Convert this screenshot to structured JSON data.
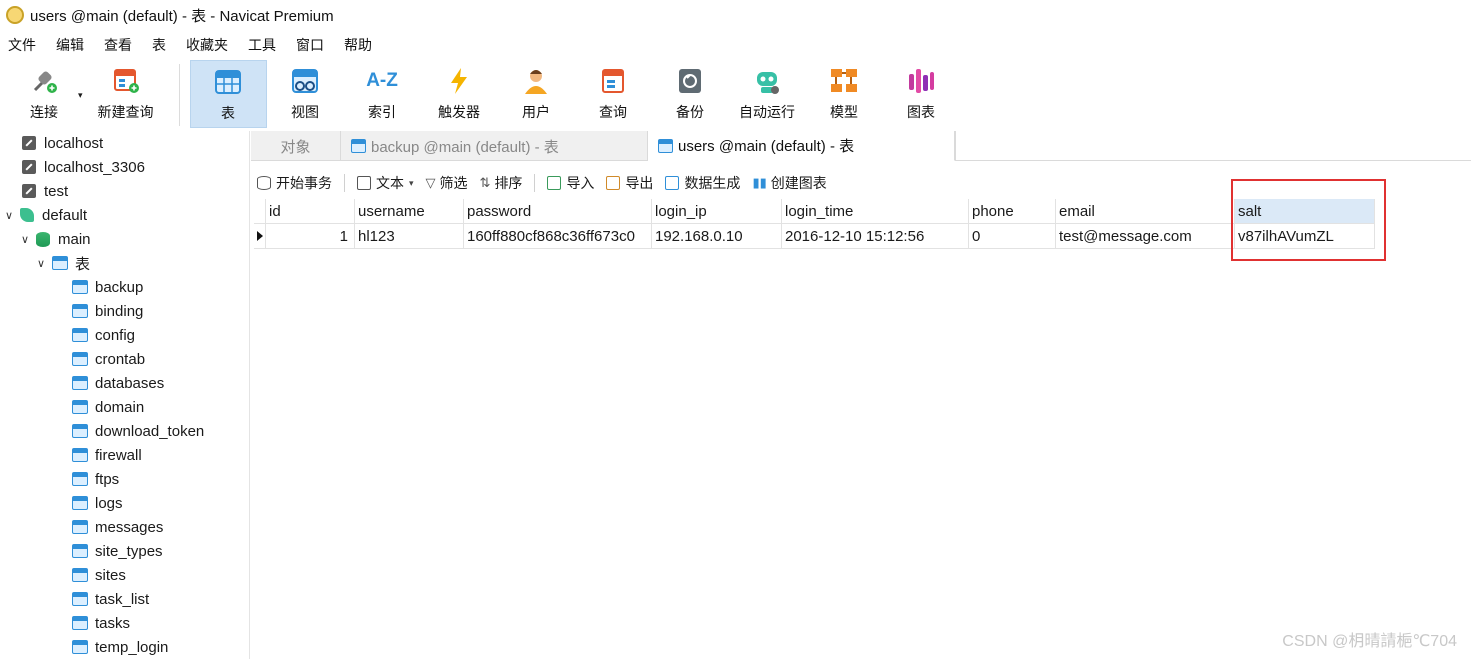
{
  "window": {
    "title": "users @main (default) - 表 - Navicat Premium"
  },
  "menu": [
    "文件",
    "编辑",
    "查看",
    "表",
    "收藏夹",
    "工具",
    "窗口",
    "帮助"
  ],
  "toolbar": {
    "connect": "连接",
    "new_query": "新建查询",
    "table": "表",
    "view": "视图",
    "index": "索引",
    "trigger": "触发器",
    "user": "用户",
    "query": "查询",
    "backup": "备份",
    "auto_run": "自动运行",
    "model": "模型",
    "chart": "图表",
    "index_icon_text": "A-Z"
  },
  "sidebar": {
    "connections": [
      "localhost",
      "localhost_3306",
      "test",
      "default"
    ],
    "database": "main",
    "tables_group": "表",
    "tables": [
      "backup",
      "binding",
      "config",
      "crontab",
      "databases",
      "domain",
      "download_token",
      "firewall",
      "ftps",
      "logs",
      "messages",
      "site_types",
      "sites",
      "task_list",
      "tasks",
      "temp_login"
    ]
  },
  "tabs": {
    "objects": "对象",
    "backup_tab": "backup @main (default) - 表",
    "users_tab": "users @main (default) - 表"
  },
  "subtoolbar": {
    "begin_transaction": "开始事务",
    "text": "文本",
    "filter": "筛选",
    "sort": "排序",
    "import": "导入",
    "export": "导出",
    "data_generate": "数据生成",
    "create_chart": "创建图表"
  },
  "grid": {
    "columns": [
      "id",
      "username",
      "password",
      "login_ip",
      "login_time",
      "phone",
      "email",
      "salt"
    ],
    "row": [
      "1",
      "hl123",
      "160ff880cf868c36ff673c0",
      "192.168.0.10",
      "2016-12-10 15:12:56",
      "0",
      "test@message.com",
      "v87ilhAVumZL"
    ]
  },
  "watermark": "CSDN @枂晴請梔℃704",
  "colors": {
    "active_tool": "#cfe3f6",
    "selected_header": "#dbe9f7",
    "highlight": "#e03131"
  }
}
